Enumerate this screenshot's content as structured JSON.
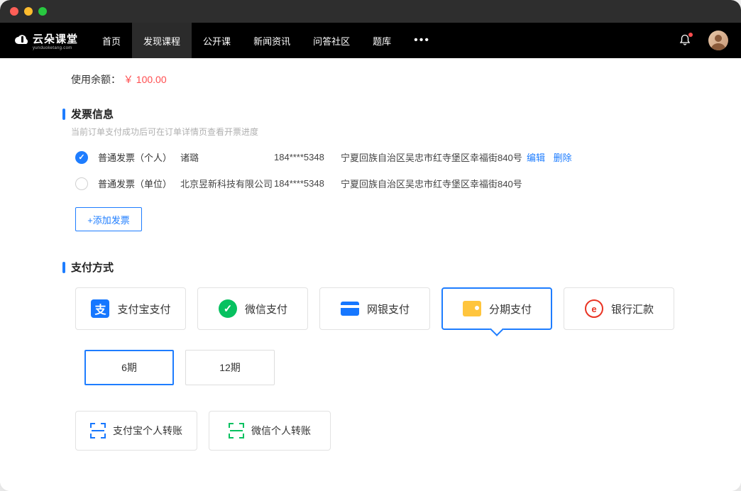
{
  "brand": {
    "name": "云朵课堂",
    "sub": "yunduoketang.com"
  },
  "nav": {
    "items": [
      "首页",
      "发现课程",
      "公开课",
      "新闻资讯",
      "问答社区",
      "题库"
    ],
    "active_index": 1
  },
  "balance": {
    "label": "使用余额：",
    "amount": "￥ 100.00"
  },
  "invoice_section": {
    "title": "发票信息",
    "subtitle": "当前订单支付成功后可在订单详情页查看开票进度",
    "rows": [
      {
        "type": "普通发票（个人）",
        "name": "诸璐",
        "phone": "184****5348",
        "address": "宁夏回族自治区吴忠市红寺堡区幸福街840号",
        "selected": true
      },
      {
        "type": "普通发票（单位）",
        "name": "北京昱新科技有限公司",
        "phone": "184****5348",
        "address": "宁夏回族自治区吴忠市红寺堡区幸福街840号",
        "selected": false
      }
    ],
    "edit_label": "编辑",
    "delete_label": "删除",
    "add_label": "+添加发票"
  },
  "payment_section": {
    "title": "支付方式",
    "methods": [
      {
        "key": "alipay",
        "label": "支付宝支付"
      },
      {
        "key": "wechat",
        "label": "微信支付"
      },
      {
        "key": "netbank",
        "label": "网银支付"
      },
      {
        "key": "installment",
        "label": "分期支付"
      },
      {
        "key": "remit",
        "label": "银行汇款"
      }
    ],
    "active_method": "installment",
    "periods": [
      {
        "label": "6期",
        "active": true
      },
      {
        "label": "12期",
        "active": false
      }
    ],
    "transfers": [
      {
        "key": "alipay-transfer",
        "label": "支付宝个人转账"
      },
      {
        "key": "wechat-transfer",
        "label": "微信个人转账"
      }
    ]
  }
}
